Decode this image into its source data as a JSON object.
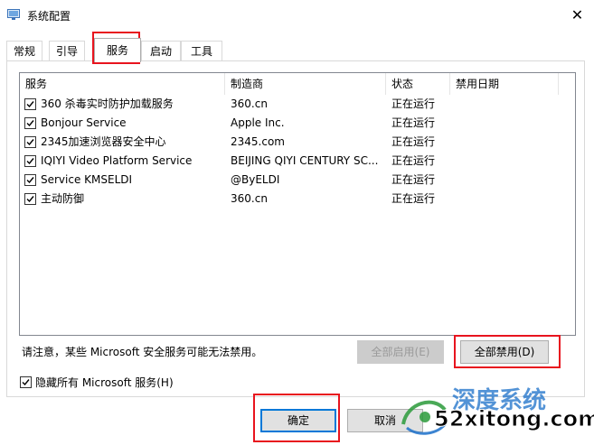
{
  "window": {
    "title": "系统配置",
    "close_glyph": "✕"
  },
  "tabs": [
    {
      "label": "常规"
    },
    {
      "label": "引导"
    },
    {
      "label": "服务",
      "active": true
    },
    {
      "label": "启动"
    },
    {
      "label": "工具"
    }
  ],
  "services_table": {
    "columns": [
      "服务",
      "制造商",
      "状态",
      "禁用日期"
    ],
    "rows": [
      {
        "checked": true,
        "service": "360 杀毒实时防护加载服务",
        "manufacturer": "360.cn",
        "status": "正在运行",
        "date_disabled": ""
      },
      {
        "checked": true,
        "service": "Bonjour Service",
        "manufacturer": "Apple Inc.",
        "status": "正在运行",
        "date_disabled": ""
      },
      {
        "checked": true,
        "service": "2345加速浏览器安全中心",
        "manufacturer": "2345.com",
        "status": "正在运行",
        "date_disabled": ""
      },
      {
        "checked": true,
        "service": "IQIYI Video Platform Service",
        "manufacturer": "BEIJING QIYI CENTURY SC...",
        "status": "正在运行",
        "date_disabled": ""
      },
      {
        "checked": true,
        "service": "Service KMSELDI",
        "manufacturer": "@ByELDI",
        "status": "正在运行",
        "date_disabled": ""
      },
      {
        "checked": true,
        "service": "主动防御",
        "manufacturer": "360.cn",
        "status": "正在运行",
        "date_disabled": ""
      }
    ]
  },
  "note": "请注意，某些 Microsoft 安全服务可能无法禁用。",
  "buttons": {
    "enable_all": "全部启用(E)",
    "disable_all": "全部禁用(D)",
    "ok": "确定",
    "cancel": "取消"
  },
  "hide_microsoft": {
    "checked": true,
    "label": "隐藏所有 Microsoft 服务(H)"
  },
  "watermark": {
    "brand": "深度系统",
    "site": "52xitong.com"
  },
  "colors": {
    "highlight": "#e8141e",
    "focus": "#0078d7",
    "watermark_green": "#2a9a3a",
    "watermark_blue": "#1a6fc9"
  }
}
